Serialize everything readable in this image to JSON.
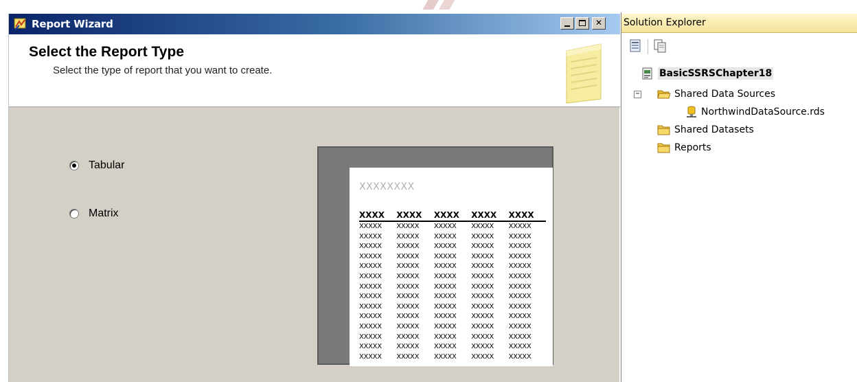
{
  "wizard": {
    "title": "Report Wizard",
    "header_title": "Select the Report Type",
    "header_subtitle": "Select the type of report that you want to create.",
    "options": [
      {
        "label": "Tabular",
        "selected": true
      },
      {
        "label": "Matrix",
        "selected": false
      }
    ],
    "preview": {
      "title": "XXXXXXXX",
      "headers": [
        "XXXX",
        "XXXX",
        "XXXX",
        "XXXX",
        "XXXX"
      ],
      "cell": "XXXXX",
      "row_count": 14
    }
  },
  "solution_explorer": {
    "title": "Solution Explorer",
    "tree": {
      "root": "BasicSSRSChapter18",
      "shared_data_sources": "Shared Data Sources",
      "data_source_file": "NorthwindDataSource.rds",
      "shared_datasets": "Shared Datasets",
      "reports": "Reports"
    }
  },
  "colors": {
    "title_bar": "#0a246a",
    "dialog_face": "#d4d0c8",
    "explorer_header": "#f4e49a",
    "folder": "#f3c84a"
  },
  "icons": [
    "wizard-icon",
    "minimize-icon",
    "maximize-icon",
    "close-icon",
    "notepad-icon",
    "properties-icon",
    "show-all-files-icon",
    "project-icon",
    "folder-open-icon",
    "datasource-icon",
    "folder-icon"
  ]
}
